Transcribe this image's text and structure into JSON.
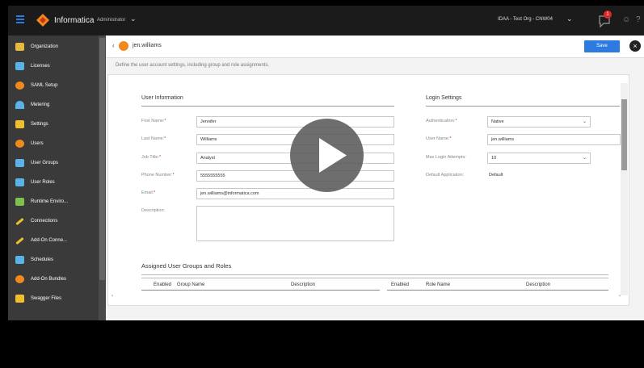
{
  "topbar": {
    "brand": "Informatica",
    "service": "Administrator",
    "org": "IDAA - Test Org - CNW04",
    "notifications": "1"
  },
  "sidebar": {
    "items": [
      {
        "label": "Organization",
        "color": "#e8b83c"
      },
      {
        "label": "Licenses",
        "color": "#5ab3e8"
      },
      {
        "label": "SAML Setup",
        "color": "#f08a1c"
      },
      {
        "label": "Metering",
        "color": "#5ab3e8"
      },
      {
        "label": "Settings",
        "color": "#f0c02c"
      },
      {
        "label": "Users",
        "color": "#f08a1c"
      },
      {
        "label": "User Groups",
        "color": "#5ab3e8"
      },
      {
        "label": "User Roles",
        "color": "#5ab3e8"
      },
      {
        "label": "Runtime Enviro...",
        "color": "#7dc24b"
      },
      {
        "label": "Connections",
        "color": "#f0c02c"
      },
      {
        "label": "Add-On Conne...",
        "color": "#f0c02c"
      },
      {
        "label": "Schedules",
        "color": "#5ab3e8"
      },
      {
        "label": "Add-On Bundles",
        "color": "#f08a1c"
      },
      {
        "label": "Swagger Files",
        "color": "#f0c02c"
      }
    ]
  },
  "header": {
    "title": "jen.williams",
    "save_label": "Save",
    "description": "Define the user account settings, including group and role assignments."
  },
  "user_info": {
    "title": "User Information",
    "first_name_label": "First Name:",
    "first_name": "Jennifer",
    "last_name_label": "Last Name:",
    "last_name": "Williams",
    "job_title_label": "Job Title:",
    "job_title": "Analyst",
    "phone_label": "Phone Number:",
    "phone": "5555555555",
    "email_label": "Email:",
    "email": "jen.williams@informatica.com",
    "description_label": "Description:"
  },
  "login": {
    "title": "Login Settings",
    "auth_label": "Authentication:",
    "auth_value": "Native",
    "username_label": "User Name:",
    "username": "jen.williams",
    "max_attempts_label": "Max Login Attempts:",
    "max_attempts": "10",
    "default_app_label": "Default Application:",
    "default_app": "Default"
  },
  "groups": {
    "title": "Assigned User Groups and Roles",
    "left_cols": [
      "Enabled",
      "Group Name",
      "Description"
    ],
    "right_cols": [
      "Enabled",
      "Role Name",
      "Description"
    ]
  },
  "accent": "#2d7be0"
}
